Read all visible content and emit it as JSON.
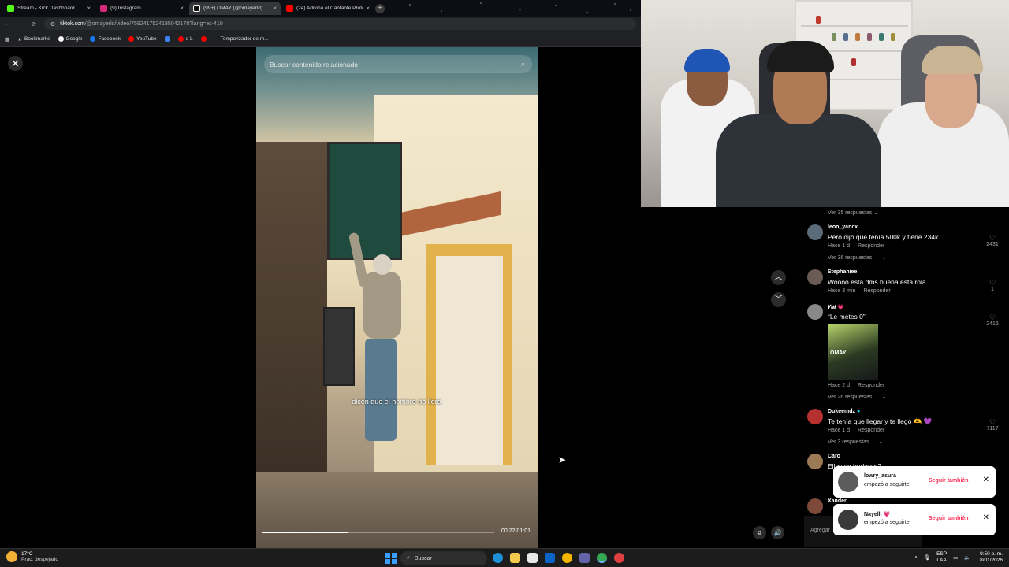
{
  "browser": {
    "tabs": [
      {
        "label": "Stream - Kick Dashboard",
        "color": "#53fc18"
      },
      {
        "label": "(9) Instagram",
        "color": "#d62976"
      },
      {
        "label": "(99+) OMAY (@omayerld) ...",
        "color": "#ffffff"
      },
      {
        "label": "(24) Adivina el Cantante Profe...",
        "color": "#ff0000"
      }
    ],
    "new_tab": "+",
    "url_host": "tiktok.com",
    "url_path": "/@omayerld/video/7592417524185042178?lang=es-419",
    "bookmarks": [
      "Bookmarks",
      "Google",
      "Facebook",
      "YouTube",
      "e L",
      "Temporizador de m..."
    ]
  },
  "video": {
    "search_placeholder": "Buscar contenido relacionado",
    "subtitle": "dicen que el hombre no llora",
    "timecode": "00:22/01:01",
    "progress": 0.37
  },
  "comments": {
    "replies_top": "Ver 35 respuestas",
    "items": [
      {
        "user": "leon_yancx",
        "text": "Pero dijo que tenía 500k y tiene 234k",
        "time": "Hace 1 d",
        "reply": "Responder",
        "likes": "2431",
        "replies": "Ver 36 respuestas",
        "avatar_color": "#5b6b7a"
      },
      {
        "user": "Stephaniee",
        "text": "Woooo está dms buena esta rola",
        "time": "Hace 3 min",
        "reply": "Responder",
        "likes": "1",
        "avatar_color": "#6a5b55"
      },
      {
        "user": "𝒀𝒆𝒊 💗",
        "text": "“Le metes 0”",
        "time": "Hace 2 d",
        "reply": "Responder",
        "likes": "2416",
        "replies": "Ver 26 respuestas",
        "image_label": "OMAY",
        "avatar_color": "#888888"
      },
      {
        "user": "Dukeemdz",
        "text": "Te tenía que llegar y te llegó 🫶 💜",
        "time": "Hace 1 d",
        "reply": "Responder",
        "likes": "7117",
        "replies": "Ver 3 respuestas",
        "avatar_color": "#b5302e"
      },
      {
        "user": "Caro",
        "text": "Ellos se burlaron?",
        "avatar_color": "#9b7a55"
      },
      {
        "user": "Xander",
        "avatar_color": "#7d4a3a"
      }
    ],
    "add_placeholder": "Agregar"
  },
  "notifications": [
    {
      "user": "lowry_asura",
      "message": "empezó a seguirte.",
      "action": "Seguir también"
    },
    {
      "user": "Nayelli 💗",
      "message": "empezó a seguirte.",
      "action": "Seguir también"
    }
  ],
  "taskbar": {
    "temperature": "17°C",
    "weather": "Prac. despejado",
    "search": "Buscar",
    "lang": "ESP",
    "lang2": "LAA",
    "time": "9:50 p. m.",
    "date": "8/01/2026"
  },
  "colors": {
    "tiktok_red": "#fe2c55",
    "bg": "#000000"
  }
}
